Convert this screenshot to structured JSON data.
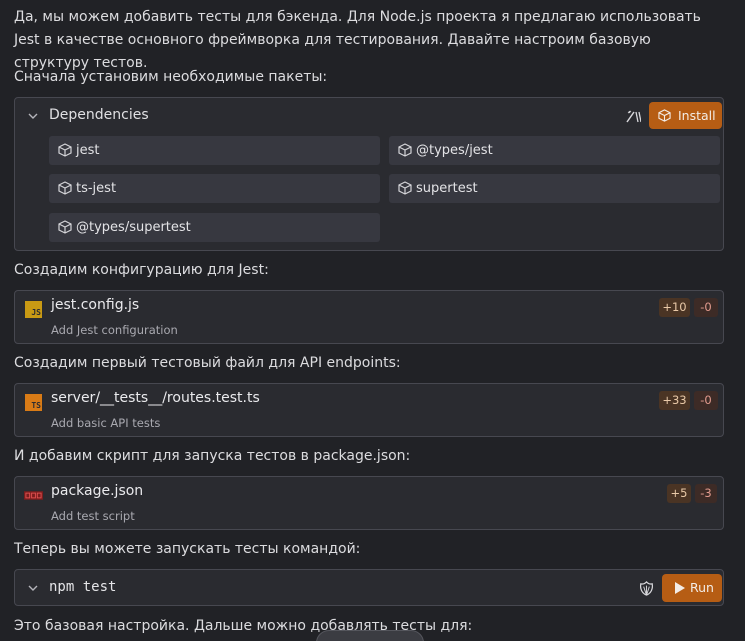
{
  "messages": {
    "intro": "Да, мы можем добавить тесты для бэкенда. Для Node.js проекта я предлагаю использовать Jest в качестве основного фреймворка для тестирования. Давайте настроим базовую структуру тестов.",
    "install_packages": "Сначала установим необходимые пакеты:",
    "create_config": "Создадим конфигурацию для Jest:",
    "create_test_file": "Создадим первый тестовый файл для API endpoints:",
    "add_script": "И добавим скрипт для запуска тестов в package.json:",
    "run_tests": "Теперь вы можете запускать тесты командой:",
    "outro": "Это базовая настройка. Дальше можно добавлять тесты для:"
  },
  "dependencies": {
    "title": "Dependencies",
    "install_label": "Install",
    "packages": [
      "jest",
      "@types/jest",
      "ts-jest",
      "supertest",
      "@types/supertest"
    ]
  },
  "files": [
    {
      "icon": "JS",
      "icon_name": "js-file-icon",
      "name": "jest.config.js",
      "description": "Add Jest configuration",
      "added": "+10",
      "removed": "-0"
    },
    {
      "icon": "TS",
      "icon_name": "ts-file-icon",
      "name": "server/__tests__/routes.test.ts",
      "description": "Add basic API tests",
      "added": "+33",
      "removed": "-0"
    },
    {
      "icon": "",
      "icon_name": "npm-file-icon",
      "name": "package.json",
      "description": "Add test script",
      "added": "+5",
      "removed": "-3"
    }
  ],
  "command": {
    "text": "npm test",
    "run_label": "Run"
  },
  "colors": {
    "accent": "#b65d14",
    "background": "#212226",
    "card": "#2a2b30"
  }
}
